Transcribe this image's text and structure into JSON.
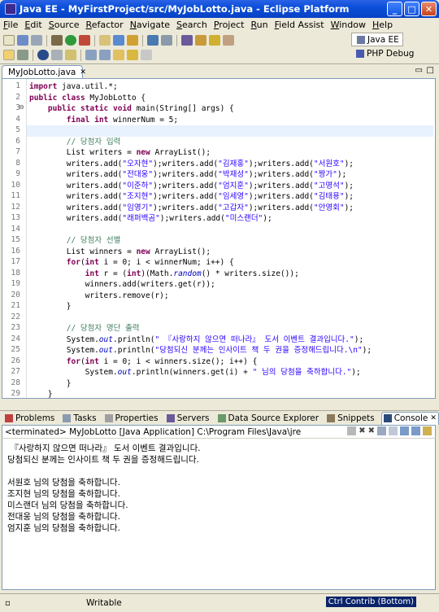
{
  "window": {
    "title": "Java EE - MyFirstProject/src/MyJobLotto.java - Eclipse Platform",
    "minimize": "_",
    "maximize": "□",
    "close": "✕"
  },
  "menu": [
    "File",
    "Edit",
    "Source",
    "Refactor",
    "Navigate",
    "Search",
    "Project",
    "Run",
    "Field Assist",
    "Window",
    "Help"
  ],
  "perspectives": {
    "active": "Java EE",
    "other": "PHP Debug"
  },
  "editor": {
    "tab": "MyJobLotto.java",
    "lines": [
      "import java.util.*;",
      "public class MyJobLotto {",
      "    public static void main(String[] args) {",
      "        final int winnerNum = 5;",
      "",
      "        // 당첨자 입력",
      "        List writers = new ArrayList();",
      "        writers.add(\"오자현\");writers.add(\"김재홍\");writers.add(\"서원호\");",
      "        writers.add(\"전대웅\");writers.add(\"박재성\");writers.add(\"짱가\");",
      "        writers.add(\"이준하\");writers.add(\"엄지훈\");writers.add(\"고명석\");",
      "        writers.add(\"조지현\");writers.add(\"임세영\");writers.add(\"김태용\");",
      "        writers.add(\"임영기\");writers.add(\"고갑자\");writers.add(\"안영회\");",
      "        writers.add(\"래퍼백곰\");writers.add(\"미스랜더\");",
      "",
      "        // 당첨자 선별",
      "        List winners = new ArrayList();",
      "        for(int i = 0; i < winnerNum; i++) {",
      "            int r = (int)(Math.random() * writers.size());",
      "            winners.add(writers.get(r));",
      "            writers.remove(r);",
      "        }",
      "",
      "        // 당첨자 명단 출력",
      "        System.out.println(\" 『사랑하지 않으면 떠나라』 도서 이벤트 결과입니다.\");",
      "        System.out.println(\"당첨되신 분께는 인사이트 책 두 권을 증정해드립니다.\\n\");",
      "        for(int i = 0; i < winners.size(); i++) {",
      "            System.out.println(winners.get(i) + \" 님의 당첨을 축하합니다.\");",
      "        }",
      "    }",
      "}"
    ]
  },
  "views": {
    "tabs": [
      "Problems",
      "Tasks",
      "Properties",
      "Servers",
      "Data Source Explorer",
      "Snippets",
      "Console"
    ],
    "console_header": "<terminated> MyJobLotto [Java Application] C:\\Program Files\\Java\\jre",
    "console_lines": [
      " 『사랑하지 않으면 떠나라』 도서 이벤트 결과입니다.",
      "당첨되신 분께는 인사이트 책 두 권을 증정해드립니다.",
      "",
      "서원호 님의 당첨을 축하합니다.",
      "조지현 님의 당첨을 축하합니다.",
      "미스랜더 님의 당첨을 축하합니다.",
      "전대웅 님의 당첨을 축하합니다.",
      "엄지훈 님의 당첨을 축하합니다."
    ]
  },
  "status": {
    "writable": "Writable",
    "contrib": "Ctrl Contrib (Bottom)"
  }
}
